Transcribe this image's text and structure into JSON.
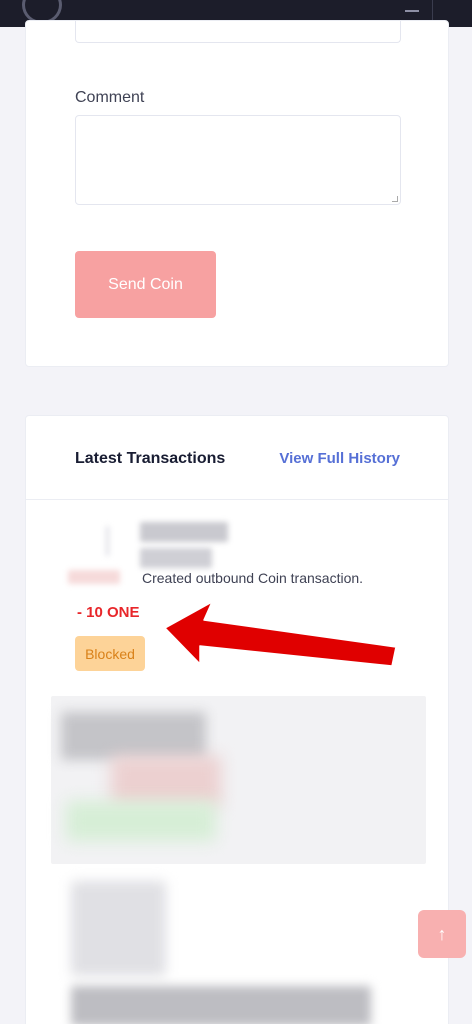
{
  "form": {
    "comment_label": "Comment",
    "comment_value": "",
    "send_button": "Send Coin"
  },
  "transactions": {
    "title": "Latest Transactions",
    "view_history": "View Full History",
    "items": [
      {
        "description": "Created outbound Coin transaction.",
        "amount": "- 10 ONE",
        "status": "Blocked"
      }
    ]
  },
  "icons": {
    "scroll_top": "arrow-up-icon",
    "logo": "logo-icon",
    "menu": "menu-icon"
  },
  "colors": {
    "send_button": "#f7a1a1",
    "link": "#5670d6",
    "amount_negative": "#e8262a",
    "badge_bg": "#fdd398",
    "badge_text": "#d98119",
    "annotation_arrow": "#e00000"
  }
}
